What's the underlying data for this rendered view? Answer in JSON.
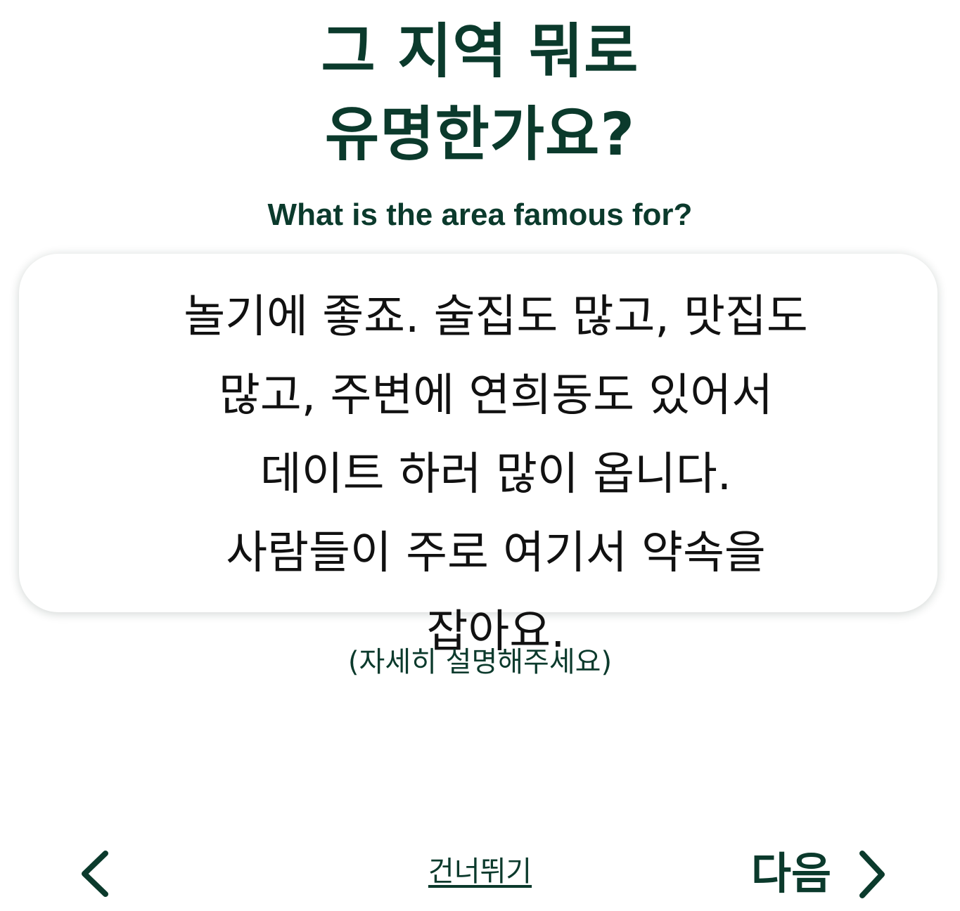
{
  "question": {
    "title": "그 지역 뭐로\n유명한가요?",
    "subtitle": "What is the area famous for?"
  },
  "answer": {
    "text": "놀기에 좋죠. 술집도 많고, 맛집도 많고, 주변에 연희동도 있어서 데이트 하러 많이 옵니다. 사람들이 주로 여기서 약속을 잡아요."
  },
  "hint": "(자세히 설명해주세요)",
  "navigation": {
    "back_icon": "chevron-left-icon",
    "skip_label": "건너뛰기",
    "next_label": "다음",
    "next_icon": "chevron-right-icon"
  },
  "colors": {
    "accent": "#0b3a2c",
    "answer_text": "#111111",
    "background": "#ffffff"
  }
}
